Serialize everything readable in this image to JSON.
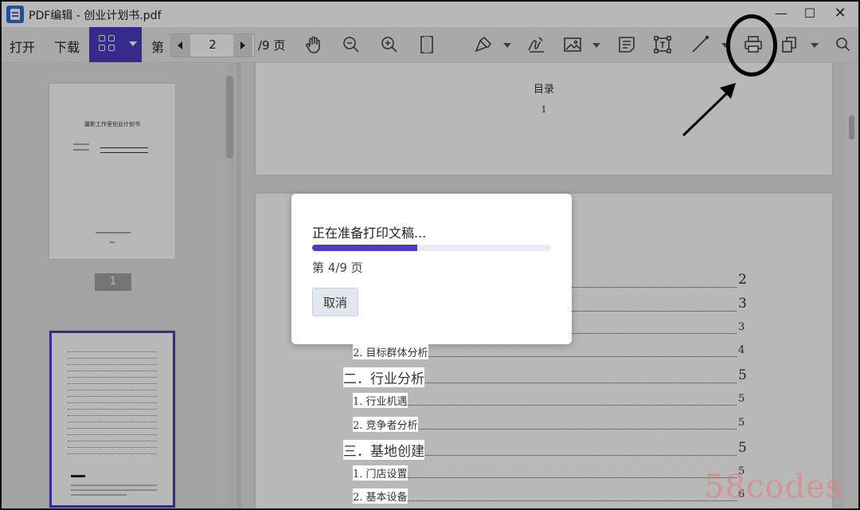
{
  "window": {
    "title": "PDF编辑 - 创业计划书.pdf"
  },
  "toolbar": {
    "open_label": "打开",
    "download_label": "下载",
    "page_prefix": "第",
    "current_page": "2",
    "page_total": "/9 页"
  },
  "left_panel": {
    "thumb1_title": "摄影工作室创业计划书",
    "thumb1_page_badge": "1"
  },
  "document": {
    "page1": {
      "heading": "目录",
      "page_no": "1"
    },
    "toc": [
      {
        "text": "",
        "page": "2",
        "size": "big"
      },
      {
        "text": "",
        "page": "3",
        "size": "big"
      },
      {
        "text": "",
        "page": "3",
        "size": "small"
      },
      {
        "text": "2. 目标群体分析",
        "page": "4",
        "size": "small"
      },
      {
        "text": "二．行业分析",
        "page": "5",
        "size": "big"
      },
      {
        "text": "1. 行业机遇",
        "page": "5",
        "size": "small"
      },
      {
        "text": "2. 竞争者分析",
        "page": "5",
        "size": "small"
      },
      {
        "text": "三．基地创建",
        "page": "5",
        "size": "big"
      },
      {
        "text": "1. 门店设置",
        "page": "5",
        "size": "small"
      },
      {
        "text": "2. 基本设备",
        "page": "6",
        "size": "small"
      }
    ]
  },
  "dialog": {
    "message": "正在准备打印文稿...",
    "progress_fraction": 0.44,
    "page_status": "第 4/9 页",
    "cancel_label": "取消"
  },
  "watermark": "58codes",
  "colors": {
    "accent": "#4b3cc4",
    "annotation": "#000000"
  }
}
